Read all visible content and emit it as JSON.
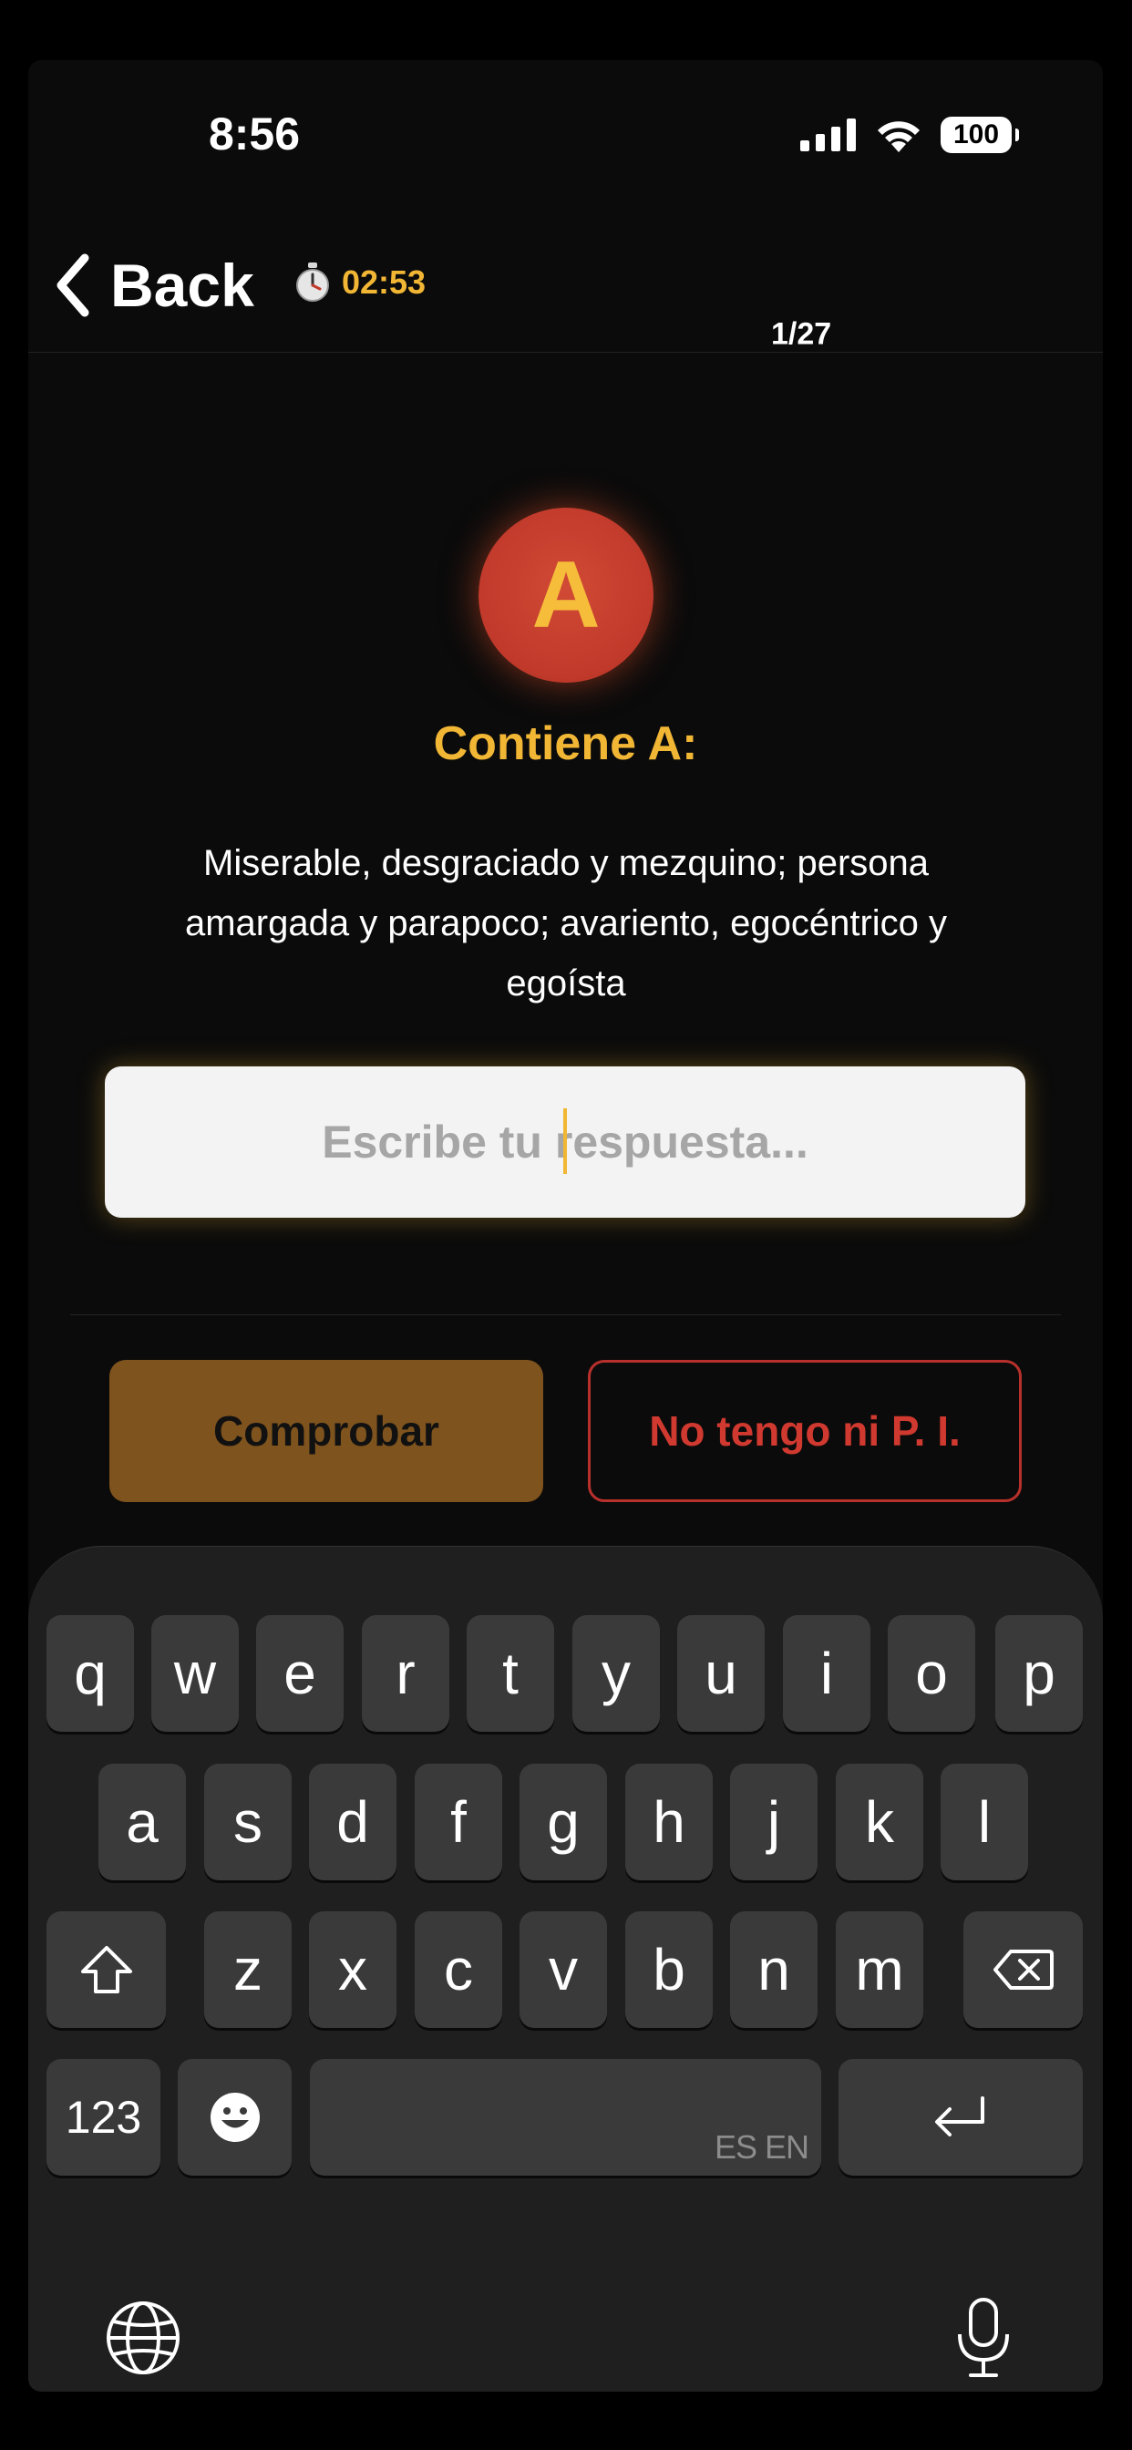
{
  "status_bar": {
    "time": "8:56",
    "battery": "100"
  },
  "nav": {
    "back_label": "Back",
    "timer": "02:53",
    "timer_icon": "stopwatch-icon",
    "progress": "1/27"
  },
  "question": {
    "letter": "A",
    "title": "Contiene A:",
    "definition": "Miserable, desgraciado y mezquino; persona amargada y parapoco; avariento, egocéntrico y egoísta"
  },
  "answer": {
    "placeholder": "Escribe tu respuesta...",
    "value": ""
  },
  "buttons": {
    "check": "Comprobar",
    "skip": "No tengo ni P. I."
  },
  "colors": {
    "accent": "#f2b635",
    "danger": "#c0392b",
    "check_button": "#7f531d",
    "background": "#0b0b0b"
  },
  "keyboard": {
    "row1": [
      "q",
      "w",
      "e",
      "r",
      "t",
      "y",
      "u",
      "i",
      "o",
      "p"
    ],
    "row2": [
      "a",
      "s",
      "d",
      "f",
      "g",
      "h",
      "j",
      "k",
      "l"
    ],
    "row3": [
      "z",
      "x",
      "c",
      "v",
      "b",
      "n",
      "m"
    ],
    "numbers_key": "123",
    "space_languages": "ES EN",
    "icons": [
      "shift-icon",
      "delete-icon",
      "emoji-icon",
      "return-icon",
      "globe-icon",
      "microphone-icon"
    ]
  }
}
